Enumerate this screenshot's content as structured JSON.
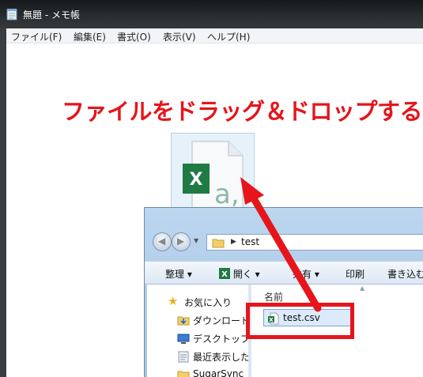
{
  "notepad": {
    "title": "無題 - メモ帳",
    "menus": [
      "ファイル(F)",
      "編集(E)",
      "書式(O)",
      "表示(V)",
      "ヘルプ(H)"
    ]
  },
  "annotation": {
    "text": "ファイルをドラッグ＆ドロップする",
    "color": "#e5151b"
  },
  "drag_file": {
    "icon": "excel-csv-file-icon"
  },
  "explorer": {
    "path": "test",
    "toolbar": {
      "organize": "整理",
      "open": "開く",
      "share": "共有",
      "print": "印刷",
      "burn": "書き込む"
    },
    "nav_tree": [
      {
        "label": "お気に入り",
        "icon": "star-icon"
      },
      {
        "label": "ダウンロード",
        "icon": "downloads-folder-icon"
      },
      {
        "label": "デスクトップ",
        "icon": "desktop-icon"
      },
      {
        "label": "最近表示した場所",
        "icon": "recent-places-icon"
      },
      {
        "label": "SugarSync",
        "icon": "folder-icon"
      }
    ],
    "columns": {
      "name": "名前"
    },
    "files": [
      {
        "name": "test.csv",
        "icon": "excel-csv-file-icon",
        "selected": true
      }
    ]
  }
}
